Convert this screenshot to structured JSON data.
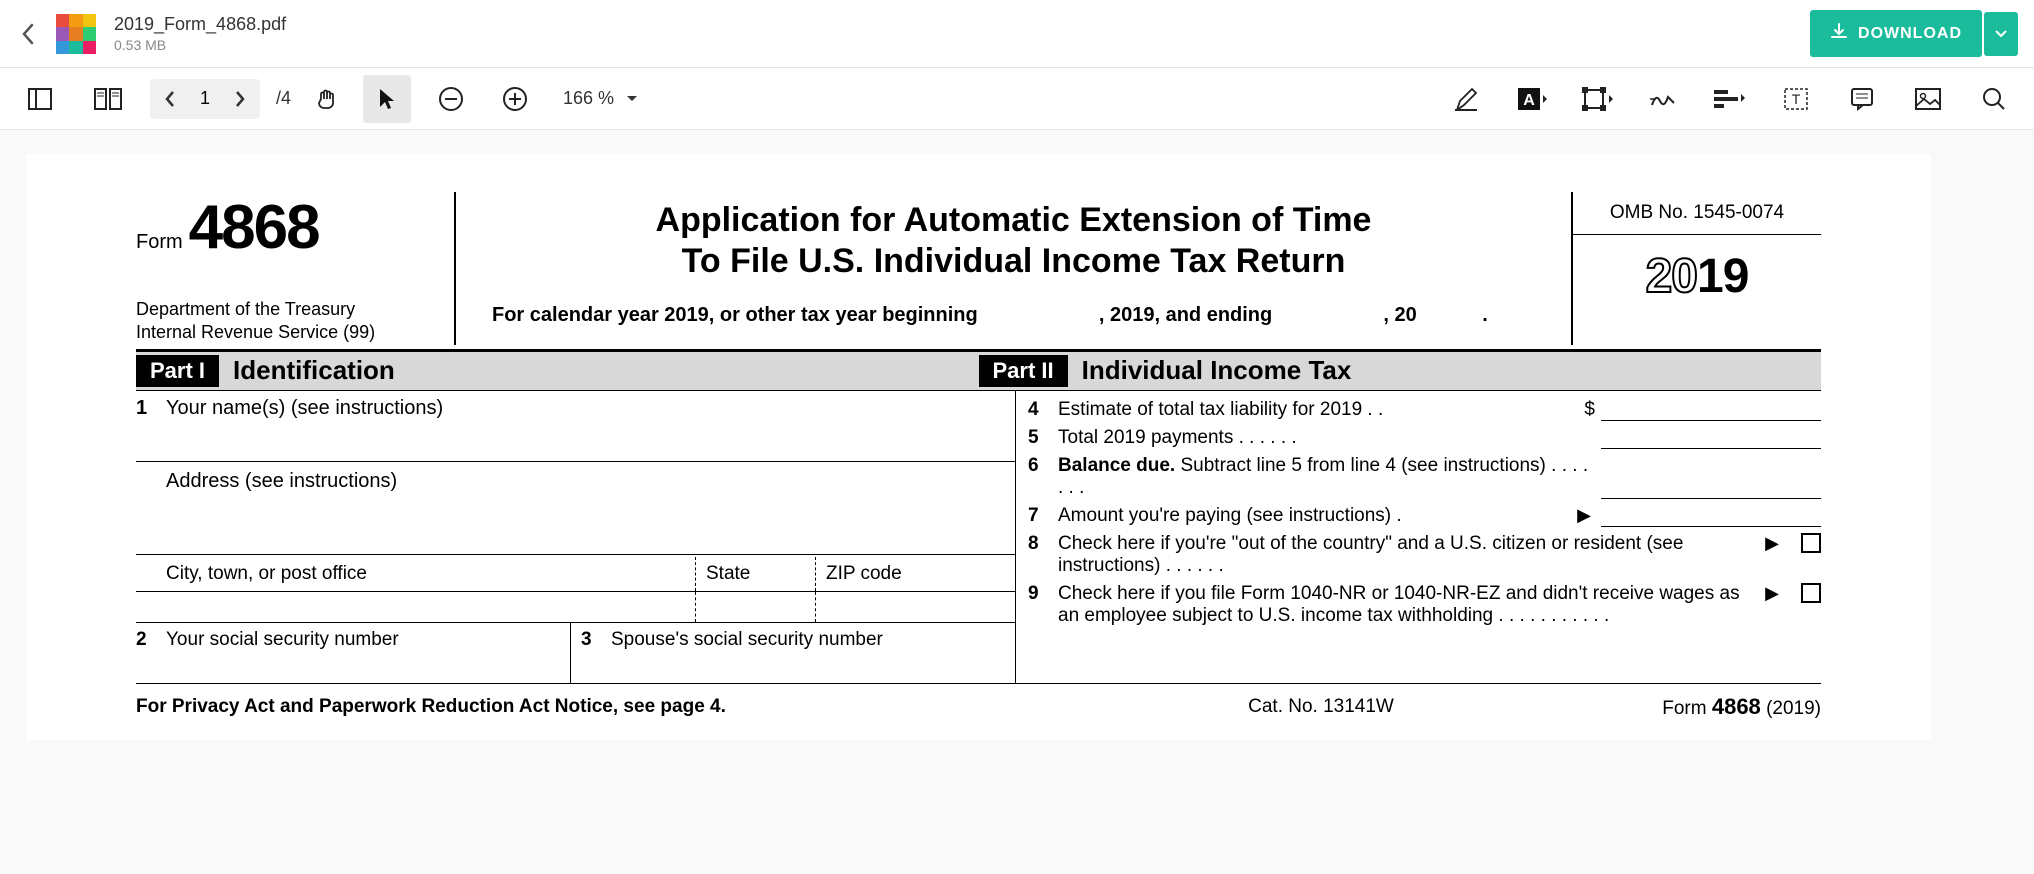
{
  "header": {
    "file_name": "2019_Form_4868.pdf",
    "file_size": "0.53 MB",
    "download_label": "DOWNLOAD"
  },
  "toolbar": {
    "current_page": "1",
    "total_pages": "/4",
    "zoom": "166 %"
  },
  "form": {
    "form_label": "Form",
    "form_number": "4868",
    "dept1": "Department of the Treasury",
    "dept2": "Internal Revenue Service (99)",
    "title1": "Application for Automatic Extension of Time",
    "title2": "To File U.S. Individual Income Tax Return",
    "cal_year_pre": "For calendar year 2019, or other tax year beginning",
    "cal_year_mid": ", 2019, and ending",
    "cal_year_end": ", 20",
    "omb": "OMB No. 1545-0074",
    "year_outline": "20",
    "year_solid": "19",
    "part1_label": "Part I",
    "part1_title": "Identification",
    "part2_label": "Part II",
    "part2_title": "Individual Income Tax",
    "line1_num": "1",
    "line1_text": "Your name(s) (see instructions)",
    "addr_label": "Address (see instructions)",
    "city_label": "City, town, or post office",
    "state_label": "State",
    "zip_label": "ZIP code",
    "line2_num": "2",
    "line2_text": "Your social security number",
    "line3_num": "3",
    "line3_text": "Spouse's social security number",
    "line4_num": "4",
    "line4_text": "Estimate of total tax liability for 2019 .   .",
    "dollar": "$",
    "line5_num": "5",
    "line5_text": "Total 2019 payments    .    .    .    .    .    .",
    "line6_num": "6",
    "line6_bold": "Balance due.",
    "line6_text": " Subtract line 5 from line 4 (see instructions)     .    .    .    .    .    .    .",
    "line7_num": "7",
    "line7_text": "Amount you're paying (see instructions) .",
    "line8_num": "8",
    "line8_text": "Check here if you're \"out of the country\" and a U.S. citizen or resident (see instructions)  .   .   .   .   .   .",
    "line9_num": "9",
    "line9_text": "Check here if you file Form 1040-NR or 1040-NR-EZ and didn't receive wages as an employee subject to U.S. income tax withholding .   .   .   .   .   .   .   .   .   .   .",
    "footer_left": "For Privacy Act and Paperwork Reduction Act Notice, see page 4.",
    "footer_center": "Cat. No. 13141W",
    "footer_right_pre": "Form ",
    "footer_right_num": "4868",
    "footer_right_yr": " (2019)"
  }
}
